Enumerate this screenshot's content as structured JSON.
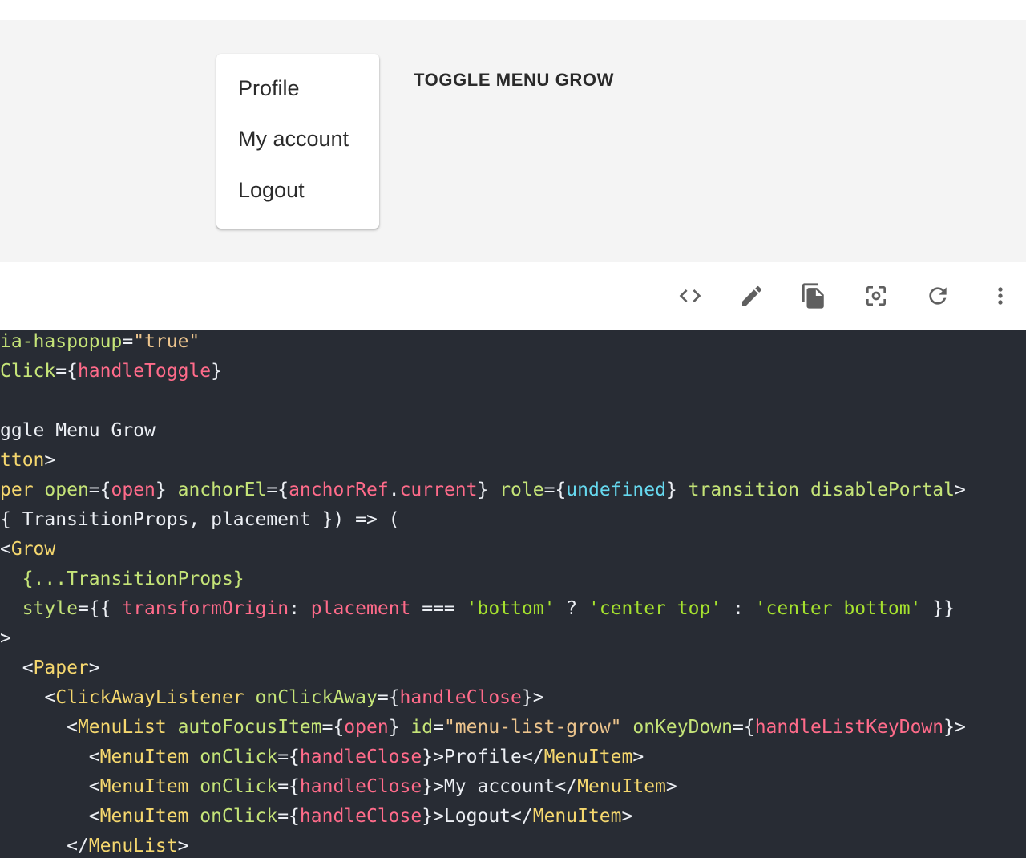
{
  "demo": {
    "menu_items": [
      "Profile",
      "My account",
      "Logout"
    ],
    "toggle_label": "TOGGLE MENU GROW"
  },
  "toolbar": {
    "buttons": [
      {
        "name": "code-icon",
        "title": "Show the source"
      },
      {
        "name": "edit-icon",
        "title": "Edit in CodeSandbox"
      },
      {
        "name": "copy-icon",
        "title": "Copy the source"
      },
      {
        "name": "focus-icon",
        "title": "Reset focus"
      },
      {
        "name": "refresh-icon",
        "title": "Reset the demo"
      },
      {
        "name": "more-vert-icon",
        "title": "See more"
      }
    ]
  },
  "colors": {
    "code_bg": "#282c34",
    "demo_bg": "#f4f4f4"
  },
  "code": {
    "lines": [
      [
        [
          "t-attr",
          "ia-haspopup"
        ],
        [
          "t-plain",
          "="
        ],
        [
          "t-str",
          "\"true\""
        ]
      ],
      [
        [
          "t-attr",
          "Click"
        ],
        [
          "t-plain",
          "={"
        ],
        [
          "t-var",
          "handleToggle"
        ],
        [
          "t-plain",
          "}"
        ]
      ],
      [],
      [
        [
          "t-plain",
          "ggle Menu Grow"
        ]
      ],
      [
        [
          "t-tag",
          "tton"
        ],
        [
          "t-plain",
          ">"
        ]
      ],
      [
        [
          "t-tag",
          "per"
        ],
        [
          "t-plain",
          " "
        ],
        [
          "t-attr",
          "open"
        ],
        [
          "t-plain",
          "={"
        ],
        [
          "t-var",
          "open"
        ],
        [
          "t-plain",
          "} "
        ],
        [
          "t-attr",
          "anchorEl"
        ],
        [
          "t-plain",
          "={"
        ],
        [
          "t-var",
          "anchorRef"
        ],
        [
          "t-plain",
          "."
        ],
        [
          "t-var",
          "current"
        ],
        [
          "t-plain",
          "} "
        ],
        [
          "t-attr",
          "role"
        ],
        [
          "t-plain",
          "={"
        ],
        [
          "t-kw",
          "undefined"
        ],
        [
          "t-plain",
          "} "
        ],
        [
          "t-attr",
          "transition"
        ],
        [
          "t-plain",
          " "
        ],
        [
          "t-attr",
          "disablePortal"
        ],
        [
          "t-plain",
          ">"
        ]
      ],
      [
        [
          "t-plain",
          "{ TransitionProps, placement }) => ("
        ]
      ],
      [
        [
          "t-plain",
          "<"
        ],
        [
          "t-tag",
          "Grow"
        ]
      ],
      [
        [
          "t-plain",
          "  "
        ],
        [
          "t-lit",
          "{...TransitionProps}"
        ]
      ],
      [
        [
          "t-plain",
          "  "
        ],
        [
          "t-attr",
          "style"
        ],
        [
          "t-plain",
          "={{ "
        ],
        [
          "t-var",
          "transformOrigin"
        ],
        [
          "t-plain",
          ": "
        ],
        [
          "t-var",
          "placement"
        ],
        [
          "t-plain",
          " === "
        ],
        [
          "t-gstr",
          "'bottom'"
        ],
        [
          "t-plain",
          " ? "
        ],
        [
          "t-gstr",
          "'center top'"
        ],
        [
          "t-plain",
          " : "
        ],
        [
          "t-gstr",
          "'center bottom'"
        ],
        [
          "t-plain",
          " }}"
        ]
      ],
      [
        [
          "t-plain",
          ">"
        ]
      ],
      [
        [
          "t-plain",
          "  <"
        ],
        [
          "t-tag",
          "Paper"
        ],
        [
          "t-plain",
          ">"
        ]
      ],
      [
        [
          "t-plain",
          "    <"
        ],
        [
          "t-tag",
          "ClickAwayListener"
        ],
        [
          "t-plain",
          " "
        ],
        [
          "t-attr",
          "onClickAway"
        ],
        [
          "t-plain",
          "={"
        ],
        [
          "t-var",
          "handleClose"
        ],
        [
          "t-plain",
          "}>"
        ]
      ],
      [
        [
          "t-plain",
          "      <"
        ],
        [
          "t-tag",
          "MenuList"
        ],
        [
          "t-plain",
          " "
        ],
        [
          "t-attr",
          "autoFocusItem"
        ],
        [
          "t-plain",
          "={"
        ],
        [
          "t-var",
          "open"
        ],
        [
          "t-plain",
          "} "
        ],
        [
          "t-attr",
          "id"
        ],
        [
          "t-plain",
          "="
        ],
        [
          "t-str",
          "\"menu-list-grow\""
        ],
        [
          "t-plain",
          " "
        ],
        [
          "t-attr",
          "onKeyDown"
        ],
        [
          "t-plain",
          "={"
        ],
        [
          "t-var",
          "handleListKeyDown"
        ],
        [
          "t-plain",
          "}>"
        ]
      ],
      [
        [
          "t-plain",
          "        <"
        ],
        [
          "t-tag",
          "MenuItem"
        ],
        [
          "t-plain",
          " "
        ],
        [
          "t-attr",
          "onClick"
        ],
        [
          "t-plain",
          "={"
        ],
        [
          "t-var",
          "handleClose"
        ],
        [
          "t-plain",
          "}>Profile</"
        ],
        [
          "t-tag",
          "MenuItem"
        ],
        [
          "t-plain",
          ">"
        ]
      ],
      [
        [
          "t-plain",
          "        <"
        ],
        [
          "t-tag",
          "MenuItem"
        ],
        [
          "t-plain",
          " "
        ],
        [
          "t-attr",
          "onClick"
        ],
        [
          "t-plain",
          "={"
        ],
        [
          "t-var",
          "handleClose"
        ],
        [
          "t-plain",
          "}>My account</"
        ],
        [
          "t-tag",
          "MenuItem"
        ],
        [
          "t-plain",
          ">"
        ]
      ],
      [
        [
          "t-plain",
          "        <"
        ],
        [
          "t-tag",
          "MenuItem"
        ],
        [
          "t-plain",
          " "
        ],
        [
          "t-attr",
          "onClick"
        ],
        [
          "t-plain",
          "={"
        ],
        [
          "t-var",
          "handleClose"
        ],
        [
          "t-plain",
          "}>Logout</"
        ],
        [
          "t-tag",
          "MenuItem"
        ],
        [
          "t-plain",
          ">"
        ]
      ],
      [
        [
          "t-plain",
          "      </"
        ],
        [
          "t-tag",
          "MenuList"
        ],
        [
          "t-plain",
          ">"
        ]
      ]
    ]
  }
}
